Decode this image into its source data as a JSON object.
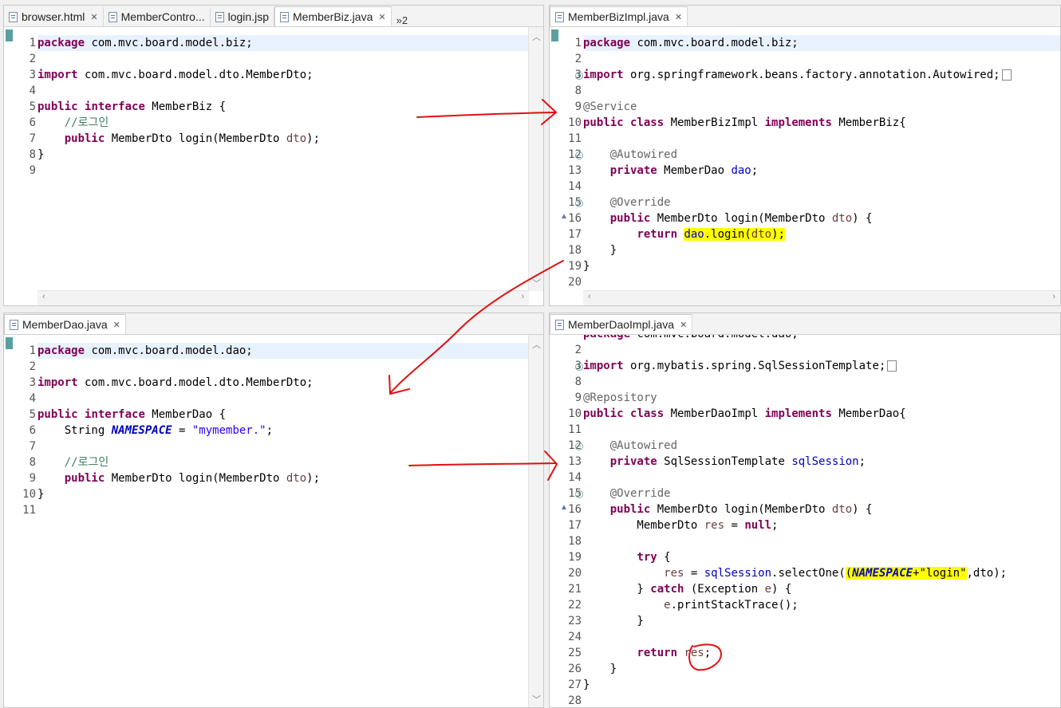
{
  "panes": {
    "top_left": {
      "tabs": [
        {
          "label": "browser.html"
        },
        {
          "label": "MemberContro..."
        },
        {
          "label": "login.jsp"
        },
        {
          "label": "MemberBiz.java"
        }
      ],
      "overflow_label": "»2",
      "lines": [
        {
          "n": "1",
          "parts": [
            {
              "t": "package",
              "c": "kw"
            },
            {
              "t": " com.mvc.board.model.biz;"
            }
          ]
        },
        {
          "n": "2",
          "parts": []
        },
        {
          "n": "3",
          "parts": [
            {
              "t": "import",
              "c": "kw"
            },
            {
              "t": " com.mvc.board.model.dto.MemberDto;"
            }
          ]
        },
        {
          "n": "4",
          "parts": []
        },
        {
          "n": "5",
          "parts": [
            {
              "t": "public",
              "c": "kw"
            },
            {
              "t": " "
            },
            {
              "t": "interface",
              "c": "kw"
            },
            {
              "t": " MemberBiz {"
            }
          ]
        },
        {
          "n": "6",
          "parts": [
            {
              "t": "    "
            },
            {
              "t": "//로그인",
              "c": "cm"
            }
          ]
        },
        {
          "n": "7",
          "parts": [
            {
              "t": "    "
            },
            {
              "t": "public",
              "c": "kw"
            },
            {
              "t": " MemberDto login(MemberDto "
            },
            {
              "t": "dto",
              "c": "par"
            },
            {
              "t": ");"
            }
          ]
        },
        {
          "n": "8",
          "parts": [
            {
              "t": "}"
            }
          ]
        },
        {
          "n": "9",
          "parts": []
        }
      ]
    },
    "top_right": {
      "tabs": [
        {
          "label": "MemberBizImpl.java"
        }
      ],
      "lines": [
        {
          "n": "1",
          "parts": [
            {
              "t": "package",
              "c": "kw"
            },
            {
              "t": " com.mvc.board.model.biz;"
            }
          ]
        },
        {
          "n": "2",
          "parts": []
        },
        {
          "n": "3",
          "fold": "+",
          "parts": [
            {
              "t": "import",
              "c": "kw"
            },
            {
              "t": " org.springframework.beans.factory.annotation.Autowired;"
            }
          ],
          "box": true
        },
        {
          "n": "8",
          "parts": []
        },
        {
          "n": "9",
          "parts": [
            {
              "t": "@Service",
              "c": "ann"
            }
          ]
        },
        {
          "n": "10",
          "parts": [
            {
              "t": "public",
              "c": "kw"
            },
            {
              "t": " "
            },
            {
              "t": "class",
              "c": "kw"
            },
            {
              "t": " MemberBizImpl "
            },
            {
              "t": "implements",
              "c": "kw"
            },
            {
              "t": " MemberBiz{"
            }
          ]
        },
        {
          "n": "11",
          "parts": []
        },
        {
          "n": "12",
          "fold": "-",
          "parts": [
            {
              "t": "    "
            },
            {
              "t": "@Autowired",
              "c": "ann"
            }
          ]
        },
        {
          "n": "13",
          "parts": [
            {
              "t": "    "
            },
            {
              "t": "private",
              "c": "kw"
            },
            {
              "t": " MemberDao "
            },
            {
              "t": "dao",
              "c": "fld"
            },
            {
              "t": ";"
            }
          ]
        },
        {
          "n": "14",
          "parts": []
        },
        {
          "n": "15",
          "fold": "-",
          "parts": [
            {
              "t": "    "
            },
            {
              "t": "@Override",
              "c": "ann"
            }
          ]
        },
        {
          "n": "16",
          "override": true,
          "parts": [
            {
              "t": "    "
            },
            {
              "t": "public",
              "c": "kw"
            },
            {
              "t": " MemberDto login(MemberDto "
            },
            {
              "t": "dto",
              "c": "par"
            },
            {
              "t": ") {"
            }
          ]
        },
        {
          "n": "17",
          "parts": [
            {
              "t": "        "
            },
            {
              "t": "return",
              "c": "kw"
            },
            {
              "t": " "
            },
            {
              "t": "dao",
              "c": "fld hl"
            },
            {
              "t": ".login(",
              "c": "hl"
            },
            {
              "t": "dto",
              "c": "par hl"
            },
            {
              "t": ");",
              "c": "hl"
            }
          ]
        },
        {
          "n": "18",
          "parts": [
            {
              "t": "    }"
            }
          ]
        },
        {
          "n": "19",
          "parts": [
            {
              "t": "}"
            }
          ]
        },
        {
          "n": "20",
          "parts": []
        }
      ]
    },
    "bottom_left": {
      "tabs": [
        {
          "label": "MemberDao.java"
        }
      ],
      "lines": [
        {
          "n": "1",
          "parts": [
            {
              "t": "package",
              "c": "kw"
            },
            {
              "t": " com.mvc.board.model.dao;"
            }
          ]
        },
        {
          "n": "2",
          "parts": []
        },
        {
          "n": "3",
          "parts": [
            {
              "t": "import",
              "c": "kw"
            },
            {
              "t": " com.mvc.board.model.dto.MemberDto;"
            }
          ]
        },
        {
          "n": "4",
          "parts": []
        },
        {
          "n": "5",
          "parts": [
            {
              "t": "public",
              "c": "kw"
            },
            {
              "t": " "
            },
            {
              "t": "interface",
              "c": "kw"
            },
            {
              "t": " MemberDao {"
            }
          ]
        },
        {
          "n": "6",
          "parts": [
            {
              "t": "    String "
            },
            {
              "t": "NAMESPACE",
              "c": "cst"
            },
            {
              "t": " = "
            },
            {
              "t": "\"mymember.\"",
              "c": "str"
            },
            {
              "t": ";"
            }
          ]
        },
        {
          "n": "7",
          "parts": []
        },
        {
          "n": "8",
          "parts": [
            {
              "t": "    "
            },
            {
              "t": "//로그인",
              "c": "cm"
            }
          ]
        },
        {
          "n": "9",
          "parts": [
            {
              "t": "    "
            },
            {
              "t": "public",
              "c": "kw"
            },
            {
              "t": " MemberDto login(MemberDto "
            },
            {
              "t": "dto",
              "c": "par"
            },
            {
              "t": ");"
            }
          ]
        },
        {
          "n": "10",
          "parts": [
            {
              "t": "}"
            }
          ]
        },
        {
          "n": "11",
          "parts": []
        }
      ]
    },
    "bottom_right": {
      "tabs": [
        {
          "label": "MemberDaoImpl.java"
        }
      ],
      "lines": [
        {
          "n": "",
          "parts": [
            {
              "t": "package",
              "c": "kw"
            },
            {
              "t": " com.mvc.board.model.dao;"
            }
          ]
        },
        {
          "n": "2",
          "parts": []
        },
        {
          "n": "3",
          "fold": "+",
          "parts": [
            {
              "t": "import",
              "c": "kw"
            },
            {
              "t": " org.mybatis.spring.SqlSessionTemplate;"
            }
          ],
          "box": true
        },
        {
          "n": "8",
          "parts": []
        },
        {
          "n": "9",
          "parts": [
            {
              "t": "@Repository",
              "c": "ann"
            }
          ]
        },
        {
          "n": "10",
          "parts": [
            {
              "t": "public",
              "c": "kw"
            },
            {
              "t": " "
            },
            {
              "t": "class",
              "c": "kw"
            },
            {
              "t": " MemberDaoImpl "
            },
            {
              "t": "implements",
              "c": "kw"
            },
            {
              "t": " MemberDao{"
            }
          ]
        },
        {
          "n": "11",
          "parts": []
        },
        {
          "n": "12",
          "fold": "-",
          "parts": [
            {
              "t": "    "
            },
            {
              "t": "@Autowired",
              "c": "ann"
            }
          ]
        },
        {
          "n": "13",
          "parts": [
            {
              "t": "    "
            },
            {
              "t": "private",
              "c": "kw"
            },
            {
              "t": " SqlSessionTemplate "
            },
            {
              "t": "sqlSession",
              "c": "fld"
            },
            {
              "t": ";"
            }
          ]
        },
        {
          "n": "14",
          "parts": []
        },
        {
          "n": "15",
          "fold": "-",
          "parts": [
            {
              "t": "    "
            },
            {
              "t": "@Override",
              "c": "ann"
            }
          ]
        },
        {
          "n": "16",
          "override": true,
          "parts": [
            {
              "t": "    "
            },
            {
              "t": "public",
              "c": "kw"
            },
            {
              "t": " MemberDto login(MemberDto "
            },
            {
              "t": "dto",
              "c": "par"
            },
            {
              "t": ") {"
            }
          ]
        },
        {
          "n": "17",
          "parts": [
            {
              "t": "        MemberDto "
            },
            {
              "t": "res",
              "c": "par"
            },
            {
              "t": " = "
            },
            {
              "t": "null",
              "c": "kw"
            },
            {
              "t": ";"
            }
          ]
        },
        {
          "n": "18",
          "parts": []
        },
        {
          "n": "19",
          "parts": [
            {
              "t": "        "
            },
            {
              "t": "try",
              "c": "kw"
            },
            {
              "t": " {"
            }
          ]
        },
        {
          "n": "20",
          "parts": [
            {
              "t": "            "
            },
            {
              "t": "res",
              "c": "par"
            },
            {
              "t": " = "
            },
            {
              "t": "sqlSession",
              "c": "fld"
            },
            {
              "t": ".selectOne("
            },
            {
              "t": "(",
              "c": "hl"
            },
            {
              "t": "NAMESPACE",
              "c": "cst hl"
            },
            {
              "t": "+\"login\"",
              "c": "hl"
            },
            {
              "t": ",dto);"
            }
          ]
        },
        {
          "n": "21",
          "parts": [
            {
              "t": "        } "
            },
            {
              "t": "catch",
              "c": "kw"
            },
            {
              "t": " (Exception "
            },
            {
              "t": "e",
              "c": "par"
            },
            {
              "t": ") {"
            }
          ]
        },
        {
          "n": "22",
          "parts": [
            {
              "t": "            "
            },
            {
              "t": "e",
              "c": "par"
            },
            {
              "t": ".printStackTrace();"
            }
          ]
        },
        {
          "n": "23",
          "parts": [
            {
              "t": "        }"
            }
          ]
        },
        {
          "n": "24",
          "parts": []
        },
        {
          "n": "25",
          "parts": [
            {
              "t": "        "
            },
            {
              "t": "return",
              "c": "kw"
            },
            {
              "t": " "
            },
            {
              "t": "res",
              "c": "par"
            },
            {
              "t": ";"
            }
          ]
        },
        {
          "n": "26",
          "parts": [
            {
              "t": "    }"
            }
          ]
        },
        {
          "n": "27",
          "parts": [
            {
              "t": "}"
            }
          ]
        },
        {
          "n": "28",
          "parts": []
        }
      ]
    }
  },
  "colors": {
    "keyword": "#7f0055",
    "annotation": "#646464",
    "comment": "#3f7f5f",
    "string": "#2a00ff",
    "field": "#0000c0",
    "highlight": "#ffff00",
    "annotation_ink": "#e01010"
  },
  "icons": [
    "java-file-icon",
    "html-file-icon",
    "close-icon",
    "fold-expand-icon",
    "fold-collapse-icon",
    "override-marker-icon",
    "scroll-up-icon",
    "scroll-down-icon",
    "scroll-left-icon",
    "scroll-right-icon"
  ]
}
